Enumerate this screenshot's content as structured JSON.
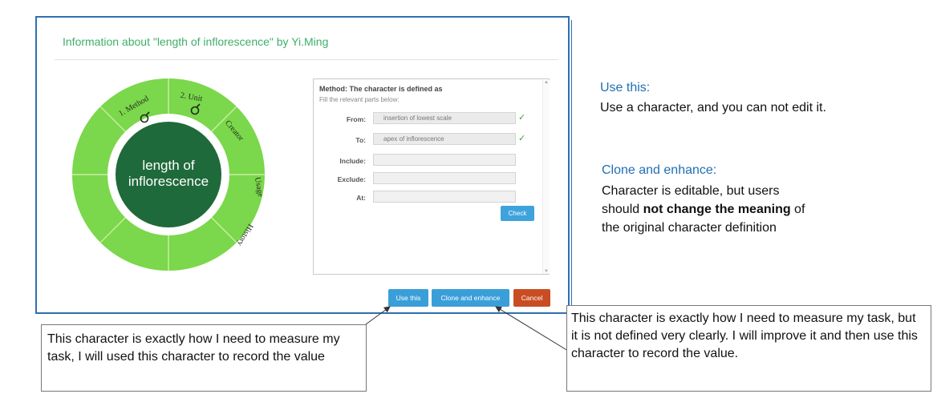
{
  "dialog": {
    "title": "Information about \"length of inflorescence\" by Yi.Ming"
  },
  "wheel": {
    "center_label_line1": "length of",
    "center_label_line2": "inflorescence",
    "segments": [
      "1. Method",
      "2. Unit",
      "Creator",
      "Usage",
      "History"
    ],
    "colors": {
      "ring": "#7bd74b",
      "inner_band": "#ffffff",
      "center": "#1f6a3a"
    }
  },
  "method_panel": {
    "heading": "Method: The character is defined as",
    "subheading": "Fill the relevant parts below:",
    "fields": [
      {
        "label": "From:",
        "value": "insertion of lowest scale",
        "checked": true
      },
      {
        "label": "To:",
        "value": "apex of inflorescence",
        "checked": true
      },
      {
        "label": "Include:",
        "value": ""
      },
      {
        "label": "Exclude:",
        "value": ""
      },
      {
        "label": "At:",
        "value": ""
      }
    ],
    "check_mark": "✓",
    "check_button": "Check"
  },
  "buttons": {
    "use": "Use this",
    "clone": "Clone and enhance",
    "cancel": "Cancel"
  },
  "notes": {
    "use_title": "Use this:",
    "use_text": "Use a character, and you can not edit it.",
    "clone_title": "Clone and enhance:",
    "clone_text_line1": "Character is editable, but users",
    "clone_text_line2_pre": "should ",
    "clone_text_line2_bold": "not change the meaning",
    "clone_text_line2_post": " of",
    "clone_text_line3": "the original character definition"
  },
  "callouts": {
    "left": "This character is exactly how I need to measure my task, I will used this character to record the value",
    "right": "This character is exactly how I need to measure my task, but it is not defined very clearly. I will improve it and then use this character to record the value."
  }
}
